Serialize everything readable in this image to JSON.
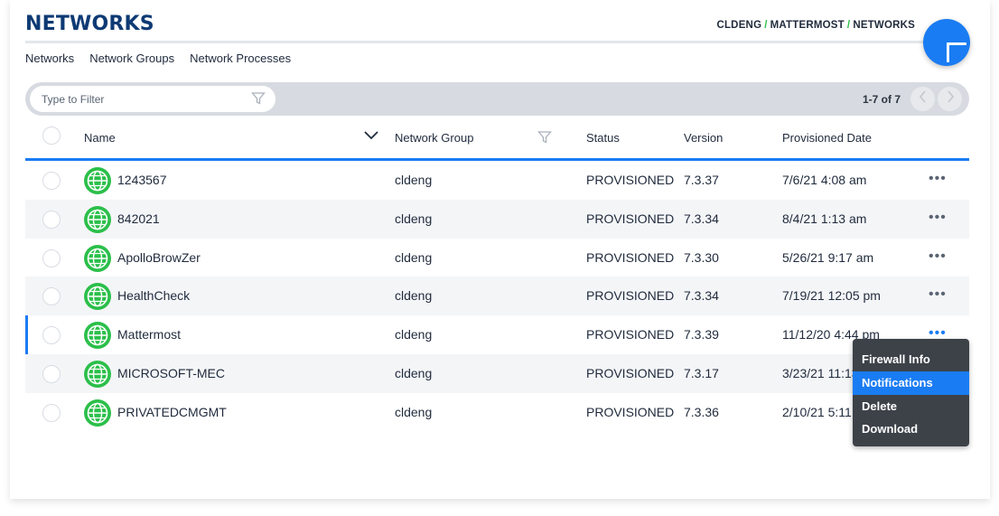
{
  "header": {
    "title": "NETWORKS",
    "breadcrumb": [
      "CLDENG",
      "MATTERMOST",
      "NETWORKS"
    ],
    "breadcrumb_separator": "/"
  },
  "subnav": [
    "Networks",
    "Network Groups",
    "Network Processes"
  ],
  "filter": {
    "placeholder": "Type to Filter",
    "value": ""
  },
  "pagination": {
    "label": "1-7 of 7"
  },
  "table": {
    "columns": {
      "name": "Name",
      "group": "Network Group",
      "status": "Status",
      "version": "Version",
      "date": "Provisioned Date"
    },
    "rows": [
      {
        "name": "1243567",
        "group": "cldeng",
        "status": "PROVISIONED",
        "version": "7.3.37",
        "date": "7/6/21 4:08 am"
      },
      {
        "name": "842021",
        "group": "cldeng",
        "status": "PROVISIONED",
        "version": "7.3.34",
        "date": "8/4/21 1:13 am"
      },
      {
        "name": "ApolloBrowZer",
        "group": "cldeng",
        "status": "PROVISIONED",
        "version": "7.3.30",
        "date": "5/26/21 9:17 am"
      },
      {
        "name": "HealthCheck",
        "group": "cldeng",
        "status": "PROVISIONED",
        "version": "7.3.34",
        "date": "7/19/21 12:05 pm"
      },
      {
        "name": "Mattermost",
        "group": "cldeng",
        "status": "PROVISIONED",
        "version": "7.3.39",
        "date": "11/12/20 4:44 pm"
      },
      {
        "name": "MICROSOFT-MEC",
        "group": "cldeng",
        "status": "PROVISIONED",
        "version": "7.3.17",
        "date": "3/23/21 11:13 am"
      },
      {
        "name": "PRIVATEDCMGMT",
        "group": "cldeng",
        "status": "PROVISIONED",
        "version": "7.3.36",
        "date": "2/10/21 5:11 pm"
      }
    ],
    "more_label": "•••"
  },
  "context_menu": {
    "items": [
      "Firewall Info",
      "Notifications",
      "Delete",
      "Download"
    ],
    "selected": "Notifications"
  },
  "colors": {
    "brand_navy": "#0e3a74",
    "accent_blue": "#1a7cf2",
    "status_green": "#2bbf4a",
    "menu_bg": "#3d4249"
  },
  "icons": {
    "fab": "plus-icon",
    "filter": "funnel-icon",
    "sort": "chevron-down-icon",
    "row": "globe-icon",
    "prev": "chevron-left-icon",
    "next": "chevron-right-icon"
  }
}
